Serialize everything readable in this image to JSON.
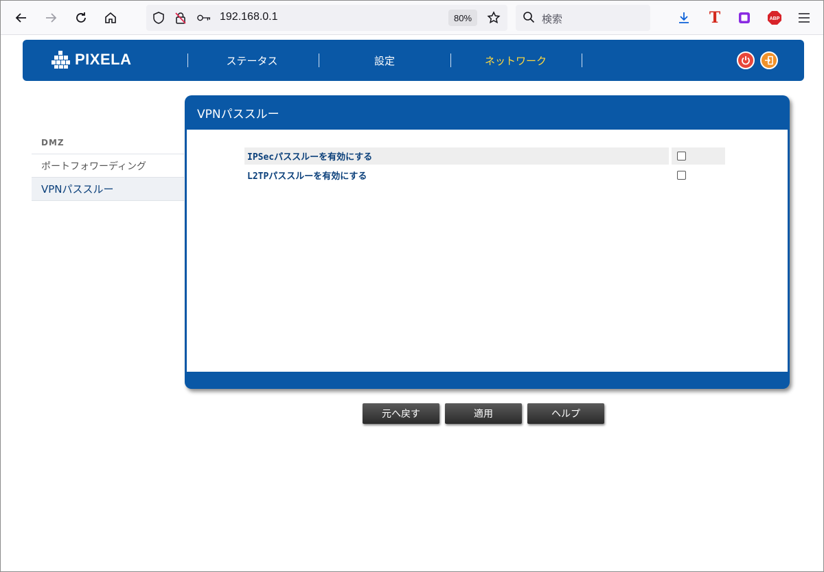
{
  "browser": {
    "url": "192.168.0.1",
    "zoom": "80%",
    "search_placeholder": "検索"
  },
  "header": {
    "brand": "PIXELA",
    "nav": [
      "ステータス",
      "設定",
      "ネットワーク"
    ],
    "active_nav": "ネットワーク"
  },
  "sidebar": {
    "items": [
      "DMZ",
      "ポートフォワーディング",
      "VPNパススルー"
    ]
  },
  "panel": {
    "title": "VPNパススルー",
    "options": [
      {
        "label": "IPSecパススルーを有効にする",
        "checked": false
      },
      {
        "label": "L2TPパススルーを有効にする",
        "checked": false
      }
    ]
  },
  "buttons": {
    "back": "元へ戻す",
    "apply": "適用",
    "help": "ヘルプ"
  },
  "colors": {
    "brand_blue": "#0a58a6",
    "active_nav": "#ffd940",
    "label_blue": "#0a3f7a"
  }
}
